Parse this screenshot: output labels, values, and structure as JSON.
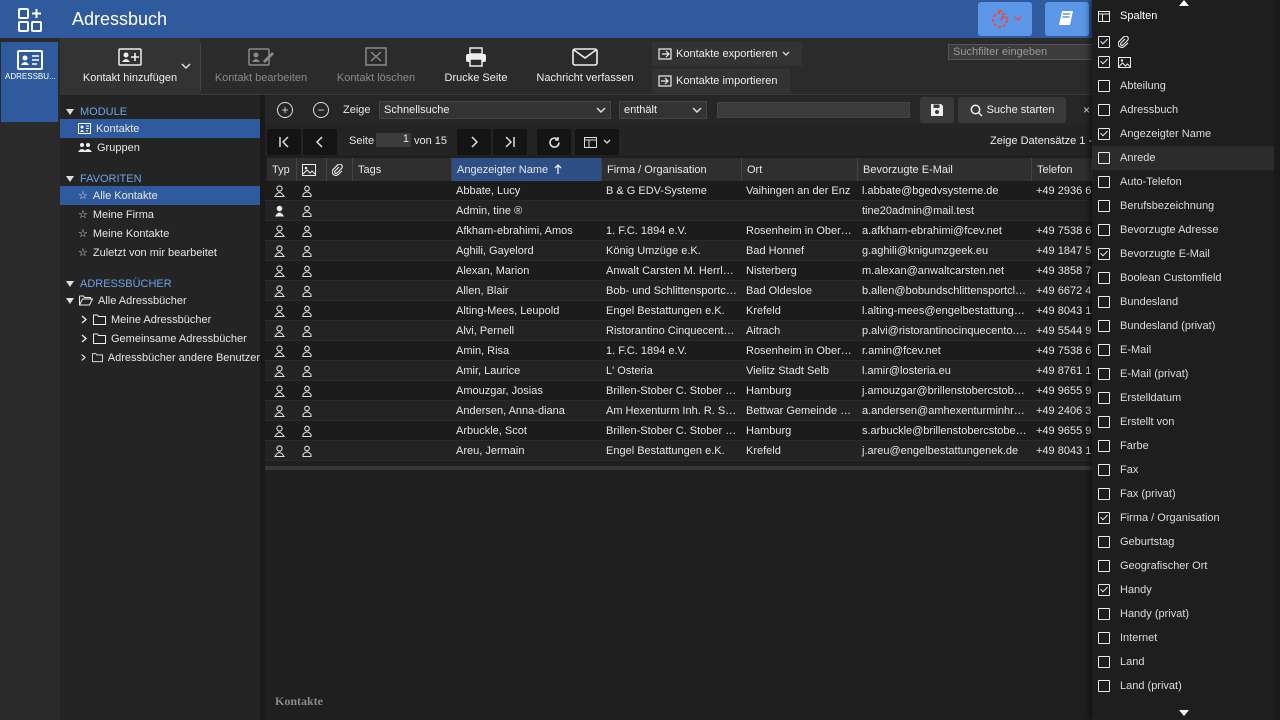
{
  "app": {
    "title": "Adressbuch",
    "rail_label": "ADRESSBU..."
  },
  "toolbar": {
    "add": "Kontakt hinzufügen",
    "edit": "Kontakt bearbeiten",
    "delete": "Kontakt löschen",
    "print": "Drucke Seite",
    "mail": "Nachricht verfassen",
    "export": "Kontakte exportieren",
    "import": "Kontakte importieren",
    "filter_placeholder": "Suchfilter eingeben"
  },
  "tree": {
    "modules_title": "MODULE",
    "modules": [
      "Kontakte",
      "Gruppen"
    ],
    "favorites_title": "FAVORITEN",
    "favorites": [
      "Alle Kontakte",
      "Meine Firma",
      "Meine Kontakte",
      "Zuletzt von mir bearbeitet"
    ],
    "books_title": "ADRESSBÜCHER",
    "books_root": "Alle Adressbücher",
    "books": [
      "Meine Adressbücher",
      "Gemeinsame Adressbücher",
      "Adressbücher andere Benutzer"
    ]
  },
  "search": {
    "show_label": "Zeige",
    "field": "Schnellsuche",
    "operator": "enthält",
    "search_button": "Suche starten"
  },
  "pager": {
    "page_label": "Seite",
    "page": "1",
    "of_label": "von 15",
    "info": "Zeige Datensätze 1 -"
  },
  "table": {
    "headers": [
      "Typ",
      "",
      "",
      "Tags",
      "Angezeigter Name",
      "Firma / Organisation",
      "Ort",
      "Bevorzugte E-Mail",
      "Telefon"
    ],
    "rows": [
      [
        "Abbate, Lucy",
        "B & G EDV-Systeme",
        "Vaihingen an der Enz",
        "l.abbate@bgedvsysteme.de",
        "+49 2936 6"
      ],
      [
        "Admin, tine ®",
        "",
        "",
        "tine20admin@mail.test",
        ""
      ],
      [
        "Afkham-ebrahimi, Amos",
        "1. F.C. 1894 e.V.",
        "Rosenheim in Ober…",
        "a.afkham-ebrahimi@fcev.net",
        "+49 7538 6"
      ],
      [
        "Aghili, Gayelord",
        "König Umzüge e.K.",
        "Bad Honnef",
        "g.aghili@knigumzgeek.eu",
        "+49 1847 5"
      ],
      [
        "Alexan, Marion",
        "Anwalt Carsten M. Herrl…",
        "Nisterberg",
        "m.alexan@anwaltcarsten.net",
        "+49 3858 7"
      ],
      [
        "Allen, Blair",
        "Bob- und Schlittensportc…",
        "Bad Oldesloe",
        "b.allen@bobundschlittensportcl…",
        "+49 6672 4"
      ],
      [
        "Alting-Mees, Leupold",
        "Engel Bestattungen e.K.",
        "Krefeld",
        "l.alting-mees@engelbestattung…",
        "+49 8043 1"
      ],
      [
        "Alvi, Pernell",
        "Ristorantino Cinquecent…",
        "Aitrach",
        "p.alvi@ristorantinocinquecento.…",
        "+49 5544 9"
      ],
      [
        "Amin, Risa",
        "1. F.C. 1894 e.V.",
        "Rosenheim in Ober…",
        "r.amin@fcev.net",
        "+49 7538 6"
      ],
      [
        "Amir, Laurice",
        "L' Osteria",
        "Vielitz Stadt Selb",
        "l.amir@losteria.eu",
        "+49 8761 1"
      ],
      [
        "Amouzgar, Josias",
        "Brillen-Stober C. Stober …",
        "Hamburg",
        "j.amouzgar@brillenstobercstob…",
        "+49 9655 9"
      ],
      [
        "Andersen, Anna-diana",
        "Am Hexenturm Inh. R. S…",
        "Bettwar Gemeinde …",
        "a.andersen@amhexenturminhr…",
        "+49 2406 3"
      ],
      [
        "Arbuckle, Scot",
        "Brillen-Stober C. Stober …",
        "Hamburg",
        "s.arbuckle@brillenstobercstobe…",
        "+49 9655 9"
      ],
      [
        "Areu, Jermain",
        "Engel Bestattungen e.K.",
        "Krefeld",
        "j.areu@engelbestattungenek.de",
        "+49 8043 1"
      ]
    ],
    "footer_title": "Kontakte"
  },
  "columns_panel": {
    "title": "Spalten",
    "options": [
      {
        "label": "",
        "icon": "paperclip-icon",
        "checked": true
      },
      {
        "label": "",
        "icon": "image-icon",
        "checked": true
      },
      {
        "label": "Abteilung",
        "checked": false
      },
      {
        "label": "Adressbuch",
        "checked": false
      },
      {
        "label": "Angezeigter Name",
        "checked": true
      },
      {
        "label": "Anrede",
        "checked": false
      },
      {
        "label": "Auto-Telefon",
        "checked": false
      },
      {
        "label": "Berufsbezeichnung",
        "checked": false
      },
      {
        "label": "Bevorzugte Adresse",
        "checked": false
      },
      {
        "label": "Bevorzugte E-Mail",
        "checked": true
      },
      {
        "label": "Boolean Customfield",
        "checked": false
      },
      {
        "label": "Bundesland",
        "checked": false
      },
      {
        "label": "Bundesland (privat)",
        "checked": false
      },
      {
        "label": "E-Mail",
        "checked": false
      },
      {
        "label": "E-Mail (privat)",
        "checked": false
      },
      {
        "label": "Erstelldatum",
        "checked": false
      },
      {
        "label": "Erstellt von",
        "checked": false
      },
      {
        "label": "Farbe",
        "checked": false
      },
      {
        "label": "Fax",
        "checked": false
      },
      {
        "label": "Fax (privat)",
        "checked": false
      },
      {
        "label": "Firma / Organisation",
        "checked": true
      },
      {
        "label": "Geburtstag",
        "checked": false
      },
      {
        "label": "Geografischer Ort",
        "checked": false
      },
      {
        "label": "Handy",
        "checked": true
      },
      {
        "label": "Handy (privat)",
        "checked": false
      },
      {
        "label": "Internet",
        "checked": false
      },
      {
        "label": "Land",
        "checked": false
      },
      {
        "label": "Land (privat)",
        "checked": false
      }
    ]
  }
}
